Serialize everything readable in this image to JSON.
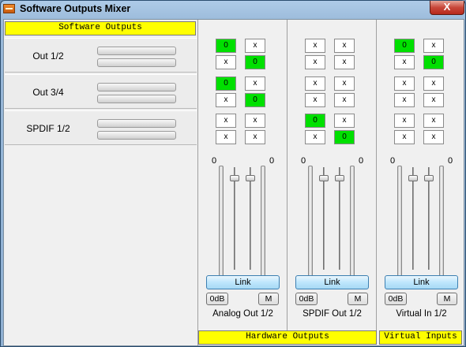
{
  "window": {
    "title": "Software Outputs Mixer",
    "close_label": "X"
  },
  "software_outputs": {
    "header": "Software Outputs",
    "rows": [
      {
        "label": "Out 1/2",
        "meters": [
          0,
          0
        ]
      },
      {
        "label": "Out 3/4",
        "meters": [
          0,
          0
        ]
      },
      {
        "label": "SPDIF 1/2",
        "meters": [
          0,
          0
        ]
      }
    ]
  },
  "hardware": {
    "header": "Hardware Outputs",
    "virtual_header": "Virtual Inputs",
    "on_color": "#00e000",
    "columns": [
      {
        "name": "Analog Out 1/2",
        "matrix": [
          [
            [
              "0",
              "x"
            ],
            [
              "x",
              "0"
            ]
          ],
          [
            [
              "0",
              "x"
            ],
            [
              "x",
              "0"
            ]
          ],
          [
            [
              "x",
              "x"
            ],
            [
              "x",
              "x"
            ]
          ]
        ],
        "fader_left": "0",
        "fader_right": "0",
        "link_label": "Link",
        "zero_db_label": "0dB",
        "mute_label": "M"
      },
      {
        "name": "SPDIF Out 1/2",
        "matrix": [
          [
            [
              "x",
              "x"
            ],
            [
              "x",
              "x"
            ]
          ],
          [
            [
              "x",
              "x"
            ],
            [
              "x",
              "x"
            ]
          ],
          [
            [
              "0",
              "x"
            ],
            [
              "x",
              "0"
            ]
          ]
        ],
        "fader_left": "0",
        "fader_right": "0",
        "link_label": "Link",
        "zero_db_label": "0dB",
        "mute_label": "M"
      },
      {
        "name": "Virtual In 1/2",
        "matrix": [
          [
            [
              "0",
              "x"
            ],
            [
              "x",
              "0"
            ]
          ],
          [
            [
              "x",
              "x"
            ],
            [
              "x",
              "x"
            ]
          ],
          [
            [
              "x",
              "x"
            ],
            [
              "x",
              "x"
            ]
          ]
        ],
        "fader_left": "0",
        "fader_right": "0",
        "link_label": "Link",
        "zero_db_label": "0dB",
        "mute_label": "M"
      }
    ]
  }
}
